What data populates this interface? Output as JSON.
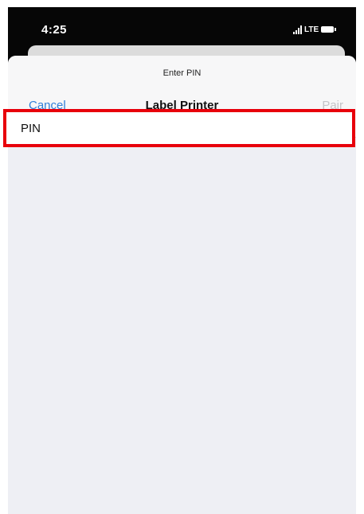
{
  "status_bar": {
    "time": "4:25",
    "network": "LTE",
    "icons": [
      "signal-bars-icon",
      "battery-icon"
    ]
  },
  "sheet": {
    "prompt": "Enter PIN",
    "cancel_label": "Cancel",
    "title": "Label Printer",
    "pair_label": "Pair"
  },
  "form": {
    "pin_label": "PIN"
  },
  "colors": {
    "accent": "#2f7fd8",
    "disabled": "#c4c4c8",
    "highlight": "#e8000b",
    "status_bar_bg": "#060606",
    "background": "#eeeff4"
  }
}
